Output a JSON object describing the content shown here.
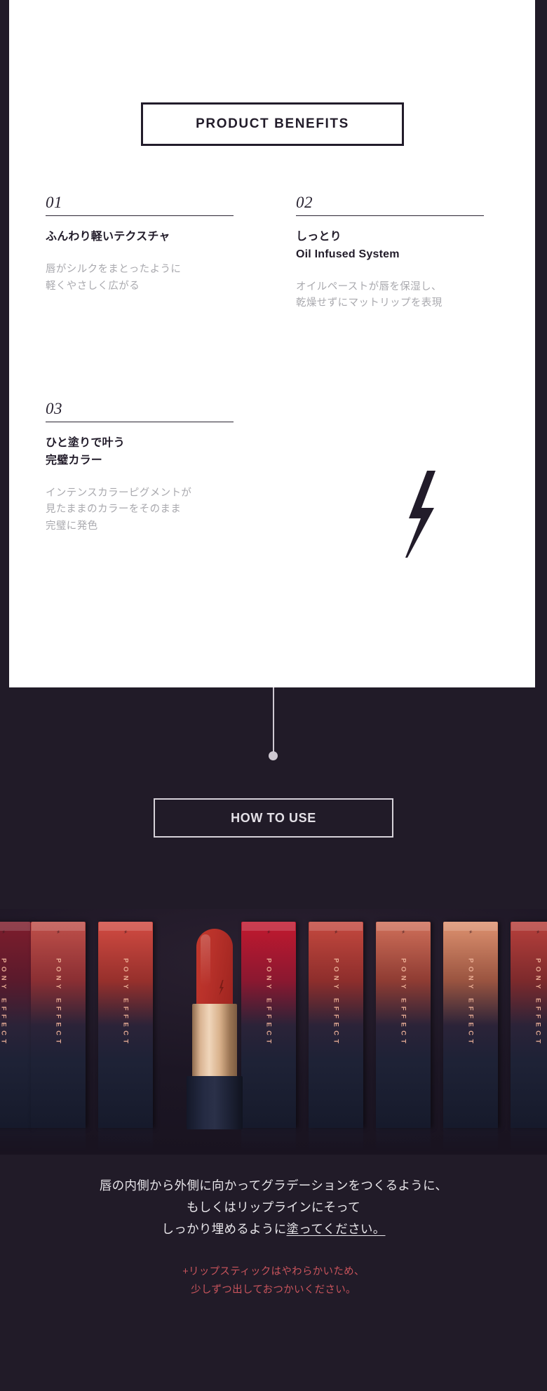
{
  "theme": {
    "dark_bg": "#211B28",
    "card_bg": "#FFFFFF",
    "ink": "#221C2A",
    "muted_text": "#A9A9AE",
    "light_text": "#E8E6EA",
    "accent_red": "#C9545C",
    "brand_copper": "#F0B49A",
    "rule": "#CFC9D2"
  },
  "benefits_section": {
    "badge_label": "PRODUCT  BENEFITS",
    "bolt_icon": "lightning-bolt-icon",
    "items": [
      {
        "number": "01",
        "title": "ふんわり軽いテクスチャ",
        "description": "唇がシルクをまとったように\n軽くやさしく広がる"
      },
      {
        "number": "02",
        "title": "しっとり\nOil Infused System",
        "description": "オイルペーストが唇を保湿し、\n乾燥せずにマットリップを表現"
      },
      {
        "number": "03",
        "title": "ひと塗りで叶う\n完璧カラー",
        "description": "インテンスカラーピグメントが\n見たままのカラーをそのまま\n完璧に発色"
      }
    ]
  },
  "how_to_use": {
    "badge_label": "HOW TO USE",
    "connector_icon": "connector-line-dot-icon"
  },
  "product_strip": {
    "brand_text": "PONY EFFECT",
    "open_lipstick_icon": "lipstick-bullet-icon",
    "tubes": [
      {
        "shade_top": "#7e1d2c",
        "shade_mid": "#5a1a2c"
      },
      {
        "shade_top": "#c0504a",
        "shade_mid": "#8a2f33"
      },
      {
        "shade_top": "#d24b42",
        "shade_mid": "#97302c"
      },
      {
        "shade_top": "#c2192f",
        "shade_mid": "#8b1830"
      },
      {
        "shade_top": "#c5493f",
        "shade_mid": "#8e2e2c"
      },
      {
        "shade_top": "#d0705a",
        "shade_mid": "#8f3c33"
      },
      {
        "shade_top": "#de9270",
        "shade_mid": "#9a5440"
      },
      {
        "shade_top": "#b8403c",
        "shade_mid": "#7d2a2c"
      }
    ]
  },
  "bottom_copy": {
    "instruction_line1": "唇の内側から外側に向かってグラデーションをつくるように、",
    "instruction_line2": "もしくはリップラインにそって",
    "instruction_line3_pre": "しっかり埋めるように",
    "instruction_line3_underline": "塗ってください。",
    "note": "+リップスティックはやわらかいため、\n少しずつ出しておつかいください。"
  }
}
